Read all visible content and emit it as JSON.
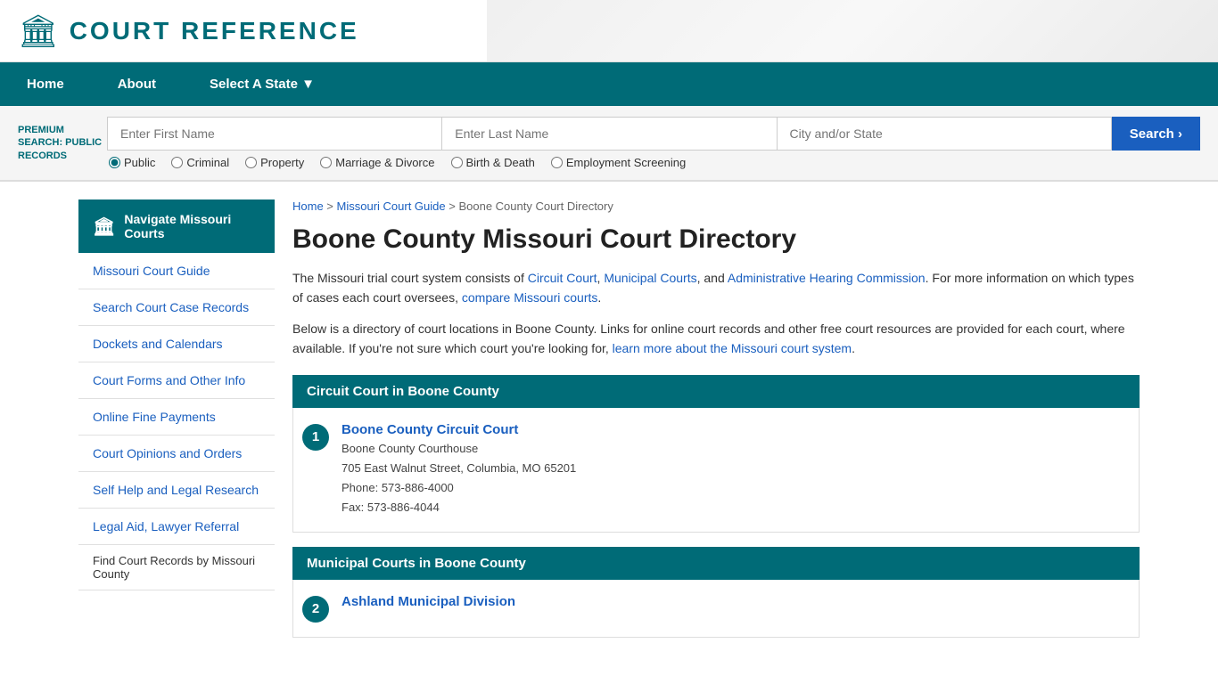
{
  "site": {
    "logo_icon": "🏛",
    "logo_text": "COURT REFERENCE"
  },
  "nav": {
    "items": [
      {
        "label": "Home",
        "id": "home"
      },
      {
        "label": "About",
        "id": "about"
      },
      {
        "label": "Select A State ▼",
        "id": "select-state"
      }
    ]
  },
  "search": {
    "premium_label": "PREMIUM SEARCH: PUBLIC RECORDS",
    "first_name_placeholder": "Enter First Name",
    "last_name_placeholder": "Enter Last Name",
    "city_placeholder": "City and/or State",
    "button_label": "Search  ›",
    "radio_options": [
      {
        "label": "Public",
        "value": "public",
        "checked": true
      },
      {
        "label": "Criminal",
        "value": "criminal"
      },
      {
        "label": "Property",
        "value": "property"
      },
      {
        "label": "Marriage & Divorce",
        "value": "marriage"
      },
      {
        "label": "Birth & Death",
        "value": "birth"
      },
      {
        "label": "Employment Screening",
        "value": "employment"
      }
    ]
  },
  "breadcrumb": {
    "home": "Home",
    "state": "Missouri Court Guide",
    "current": "Boone County Court Directory"
  },
  "page": {
    "title": "Boone County Missouri Court Directory",
    "intro": "The Missouri trial court system consists of Circuit Court, Municipal Courts, and Administrative Hearing Commission. For more information on which types of cases each court oversees, compare Missouri courts.",
    "more": "Below is a directory of court locations in Boone County. Links for online court records and other free court resources are provided for each court, where available. If you're not sure which court you're looking for, learn more about the Missouri court system."
  },
  "sidebar": {
    "active_label": "Navigate Missouri Courts",
    "items": [
      {
        "label": "Missouri Court Guide"
      },
      {
        "label": "Search Court Case Records"
      },
      {
        "label": "Dockets and Calendars"
      },
      {
        "label": "Court Forms and Other Info"
      },
      {
        "label": "Online Fine Payments"
      },
      {
        "label": "Court Opinions and Orders"
      },
      {
        "label": "Self Help and Legal Research"
      },
      {
        "label": "Legal Aid, Lawyer Referral"
      },
      {
        "label": "Find Court Records by Missouri County"
      }
    ]
  },
  "sections": [
    {
      "header": "Circuit Court in Boone County",
      "courts": [
        {
          "number": "1",
          "name": "Boone County Circuit Court",
          "address_lines": [
            "Boone County Courthouse",
            "705 East Walnut Street, Columbia, MO 65201",
            "Phone: 573-886-4000",
            "Fax: 573-886-4044"
          ]
        }
      ]
    },
    {
      "header": "Municipal Courts in Boone County",
      "courts": [
        {
          "number": "2",
          "name": "Ashland Municipal Division",
          "address_lines": []
        }
      ]
    }
  ]
}
